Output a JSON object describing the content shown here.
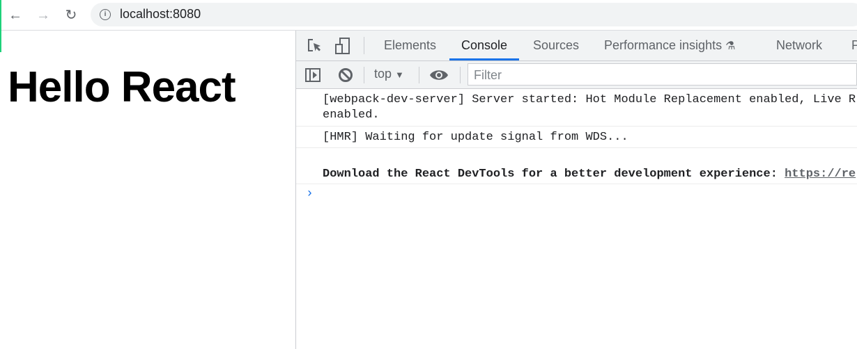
{
  "browser": {
    "url": "localhost:8080",
    "icons": [
      "back-icon",
      "forward-icon",
      "reload-icon",
      "info-icon"
    ]
  },
  "page": {
    "heading": "Hello React"
  },
  "devtools": {
    "tabs": [
      {
        "label": "Elements"
      },
      {
        "label": "Console",
        "active": true
      },
      {
        "label": "Sources"
      },
      {
        "label": "Performance insights"
      },
      {
        "label": "Network"
      },
      {
        "label": "P"
      }
    ],
    "toolbar": {
      "context": "top",
      "filter_placeholder": "Filter"
    },
    "messages": [
      {
        "text": "[webpack-dev-server] Server started: Hot Module Replacement enabled, Live R\nenabled."
      },
      {
        "text": "[HMR] Waiting for update signal from WDS..."
      },
      {
        "text": "Download the React DevTools for a better development experience: ",
        "link": "https://re"
      }
    ],
    "accent_color": "#1a73e8"
  }
}
